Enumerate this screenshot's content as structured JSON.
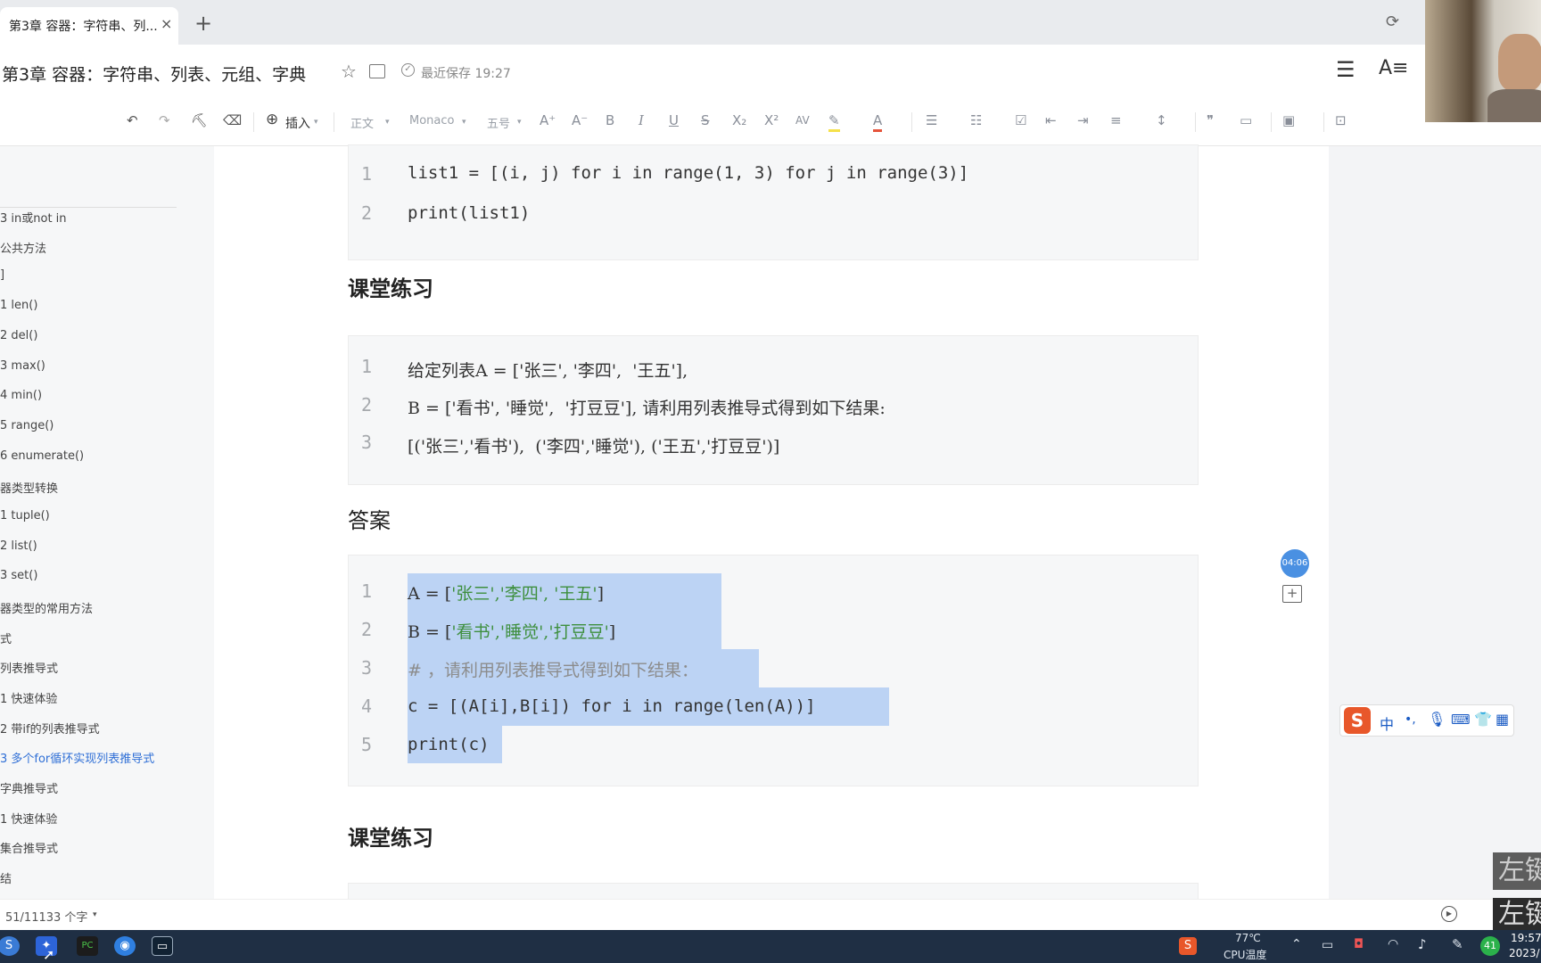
{
  "tab": {
    "title": "第3章 容器：字符串、列...",
    "close": "×",
    "new": "+"
  },
  "header": {
    "title": "第3章 容器：字符串、列表、元组、字典",
    "save_status": "最近保存 19:27"
  },
  "toolbar": {
    "insert": "插入",
    "style": "正文",
    "font": "Monaco",
    "size": "五号",
    "bold": "B",
    "italic": "I",
    "underline": "U",
    "strike": "S",
    "sub": "X₂",
    "sup": "X²"
  },
  "outline": {
    "items": [
      {
        "label": "3  in或not  in"
      },
      {
        "label": "公共方法"
      },
      {
        "label": "]"
      },
      {
        "label": "1  len()"
      },
      {
        "label": "2  del()"
      },
      {
        "label": "3  max()"
      },
      {
        "label": "4  min()"
      },
      {
        "label": "5  range()"
      },
      {
        "label": "6  enumerate()"
      },
      {
        "label": "器类型转换"
      },
      {
        "label": "1  tuple()"
      },
      {
        "label": "2  list()"
      },
      {
        "label": "3  set()"
      },
      {
        "label": "器类型的常用方法"
      },
      {
        "label": "式"
      },
      {
        "label": "列表推导式"
      },
      {
        "label": "1  快速体验"
      },
      {
        "label": "2  带if的列表推导式"
      },
      {
        "label": "3  多个for循环实现列表推导式"
      },
      {
        "label": "字典推导式"
      },
      {
        "label": "1  快速体验"
      },
      {
        "label": "集合推导式"
      },
      {
        "label": "结"
      }
    ]
  },
  "doc": {
    "code1": {
      "line1": "list1 = [(i, j) for i in range(1, 3) for j in range(3)]",
      "line2": "print(list1)"
    },
    "heading1": "课堂练习",
    "exercise": {
      "line1": "给定列表A = ['张三', '李四',  '王五'],",
      "line2": "B = ['看书', '睡觉',  '打豆豆'], 请利用列表推导式得到如下结果:",
      "line3": "[('张三','看书'),  ('李四','睡觉'), ('王五','打豆豆')]"
    },
    "heading_answer": "答案",
    "answer": {
      "l1a": "A = [",
      "l1s": "'张三','李四', '王五'",
      "l1b": "]",
      "l2a": "B = [",
      "l2s": "'看书','睡觉','打豆豆'",
      "l2b": "]",
      "l3": "# ，请利用列表推导式得到如下结果：",
      "l4": "c = [(A[i],B[i]) for i in range(len(A))]",
      "l5": "print(c)"
    },
    "heading2": "课堂练习"
  },
  "timer": "04:06",
  "statusbar": {
    "wordcount": "51/11133 个字"
  },
  "taskbar": {
    "temp": "77℃",
    "cpu": "CPU温度",
    "battery": "41",
    "time": "19:57",
    "date": "2023/"
  },
  "ime": {
    "label": "中"
  },
  "watermark": "左键"
}
